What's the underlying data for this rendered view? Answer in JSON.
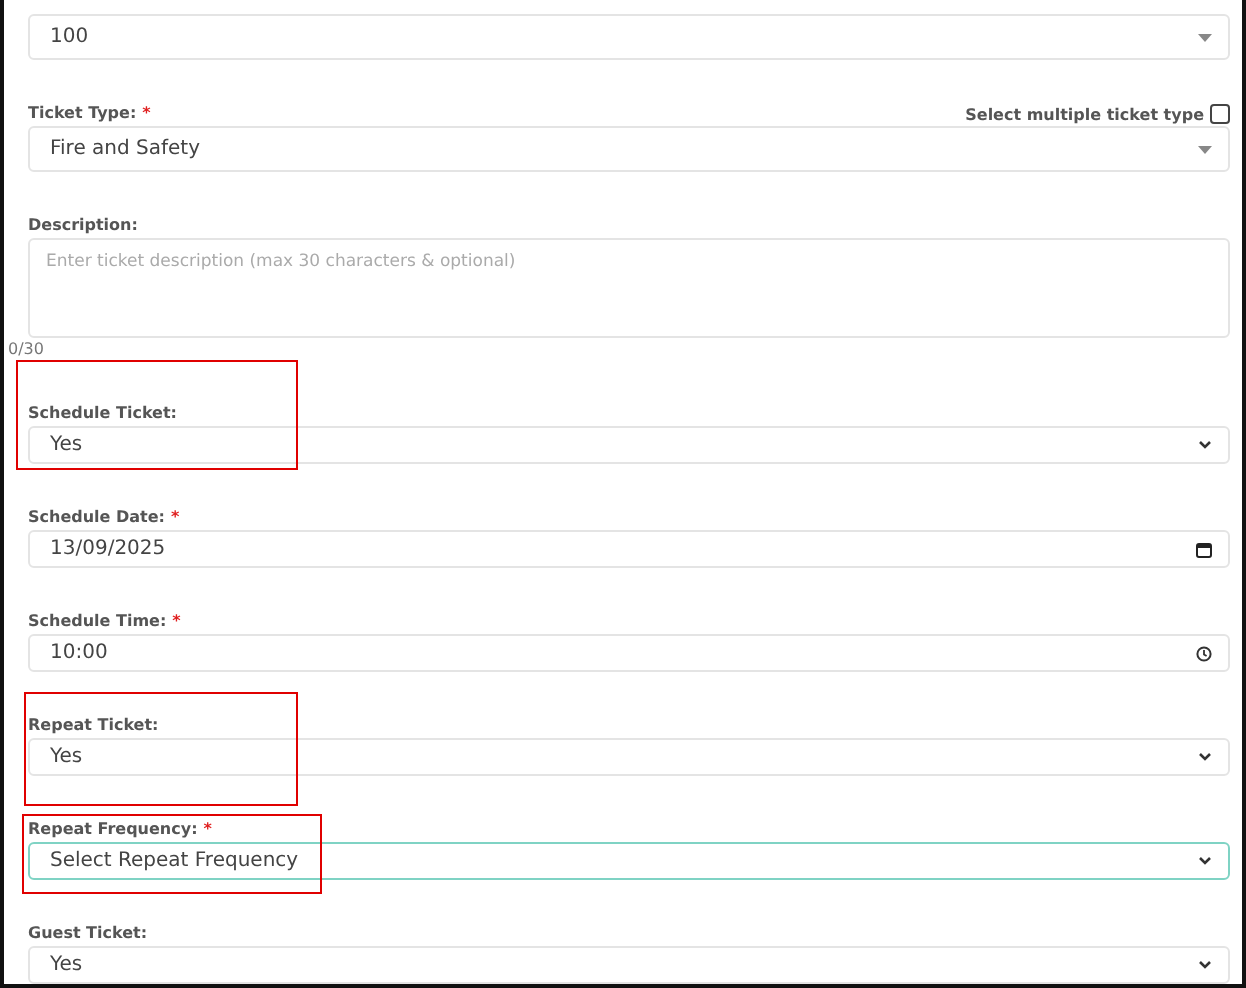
{
  "fields": [
    {
      "kind": "dropdown",
      "value": "100",
      "highlighted": false
    },
    {
      "kind": "dropdown",
      "label": "Ticket Type:",
      "required_mark": "*",
      "value": "Fire and Safety",
      "option": {
        "label": "Select multiple ticket type",
        "checked": false
      },
      "highlighted": false
    },
    {
      "kind": "textarea",
      "label": "Description:",
      "placeholder": "Enter ticket description (max 30 characters & optional)",
      "counter": "0/30",
      "highlighted": false
    },
    {
      "kind": "select",
      "label": "Schedule Ticket:",
      "value": "Yes",
      "highlighted": true,
      "focused": false
    },
    {
      "kind": "date",
      "label": "Schedule Date:",
      "required_mark": "*",
      "value": "13/09/2025",
      "highlighted": false
    },
    {
      "kind": "time",
      "label": "Schedule Time:",
      "required_mark": "*",
      "value": "10:00",
      "highlighted": false
    },
    {
      "kind": "select",
      "label": "Repeat Ticket:",
      "value": "Yes",
      "highlighted": true,
      "focused": false
    },
    {
      "kind": "select",
      "label": "Repeat Frequency:",
      "required_mark": "*",
      "value": "Select Repeat Frequency",
      "highlighted": true,
      "focused": true
    },
    {
      "kind": "select",
      "label": "Guest Ticket:",
      "value": "Yes",
      "highlighted": false,
      "focused": false
    }
  ]
}
